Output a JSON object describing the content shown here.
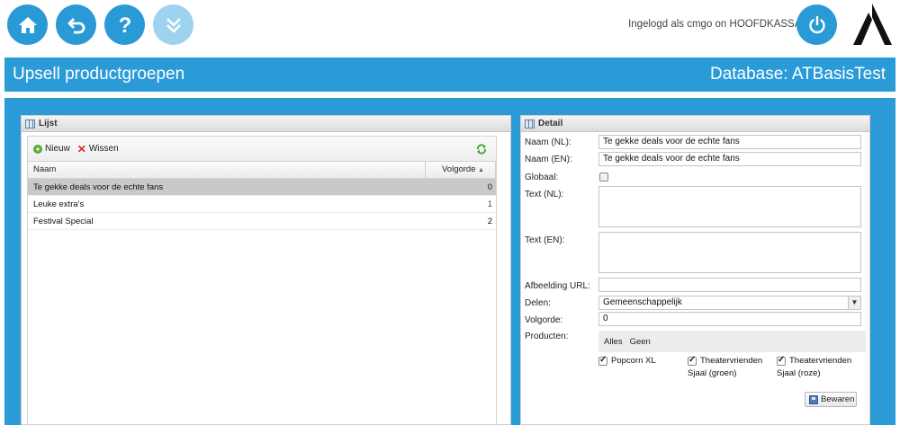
{
  "topbar": {
    "buttons": [
      {
        "name": "home-icon"
      },
      {
        "name": "back-icon"
      },
      {
        "name": "help-icon"
      },
      {
        "name": "expand-down-icon"
      }
    ],
    "login_text": "Ingelogd als cmgo on HOOFDKASSA",
    "power_icon": "power-icon",
    "logo_icon": "brand-logo-icon"
  },
  "header": {
    "title": "Upsell productgroepen",
    "database": "Database: ATBasisTest"
  },
  "colors": {
    "accent": "#2b9bd8",
    "accent_light": "#9ed3ef",
    "selected_row": "#c9c9c9"
  },
  "lijst": {
    "title": "Lijst",
    "toolbar": {
      "new_label": "Nieuw",
      "delete_label": "Wissen"
    },
    "columns": [
      "Naam",
      "Volgorde"
    ],
    "sort_indicator": "▲",
    "rows": [
      {
        "naam": "Te gekke deals voor de echte fans",
        "volgorde": "0"
      },
      {
        "naam": "Leuke extra's",
        "volgorde": "1"
      },
      {
        "naam": "Festival Special",
        "volgorde": "2"
      }
    ]
  },
  "detail": {
    "title": "Detail",
    "labels": {
      "naam_nl": "Naam (NL):",
      "naam_en": "Naam (EN):",
      "globaal": "Globaal:",
      "text_nl": "Text (NL):",
      "text_en": "Text (EN):",
      "afbeelding": "Afbeelding URL:",
      "delen": "Delen:",
      "volgorde": "Volgorde:",
      "producten": "Producten:"
    },
    "values": {
      "naam_nl": "Te gekke deals voor de echte fans",
      "naam_en": "Te gekke deals voor de echte fans",
      "globaal": false,
      "text_nl": "",
      "text_en": "",
      "afbeelding": "",
      "delen": "Gemeenschappelijk",
      "volgorde": "0"
    },
    "producten_links": {
      "all": "Alles",
      "none": "Geen"
    },
    "products": [
      {
        "line1": "Popcorn XL",
        "line2": "",
        "checked": true
      },
      {
        "line1": "Theatervrienden",
        "line2": "Sjaal (groen)",
        "checked": true
      },
      {
        "line1": "Theatervrienden",
        "line2": "Sjaal (roze)",
        "checked": true
      }
    ],
    "save_label": "Bewaren"
  }
}
